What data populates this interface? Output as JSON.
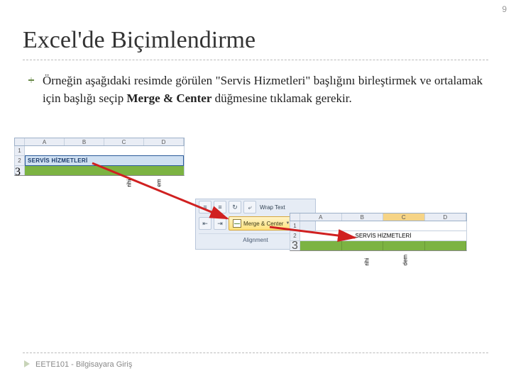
{
  "page_number": "9",
  "title": "Excel'de Biçimlendirme",
  "body": {
    "p1a": "Örneğin aşağıdaki resimde görülen \"Servis Hizmetleri\" başlığını birleştirmek ve ortalamak için başlığı seçip ",
    "p1b": "Merge & Center",
    "p1c": " düğmesine tıklamak gerekir."
  },
  "snippet1": {
    "cell_text": "SERVİS HİZMETLERİ",
    "cols": [
      "",
      "A",
      "B",
      "C",
      "D"
    ],
    "rows": [
      "1",
      "2",
      "3"
    ],
    "vlabel1": "rihi",
    "vlabel2": "em"
  },
  "ribbon": {
    "wrap": "Wrap Text",
    "merge": "Merge & Center",
    "group": "Alignment"
  },
  "snippet2": {
    "cols": [
      "",
      "A",
      "B",
      "C",
      "D"
    ],
    "rows": [
      "1",
      "2",
      "3"
    ],
    "merged_text": "SERVİS HİZMETLERİ",
    "vlabel1": "rihi",
    "vlabel2": "dem"
  },
  "footer": "EETE101 - Bilgisayara Giriş"
}
